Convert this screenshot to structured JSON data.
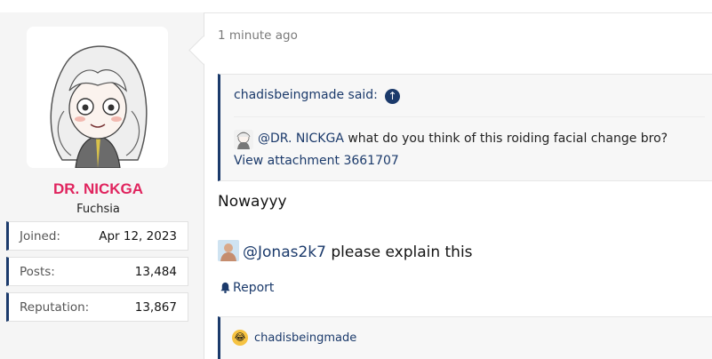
{
  "user": {
    "name": "DR. NICKGA",
    "title": "Fuchsia",
    "stats": [
      {
        "label": "Joined:",
        "value": "Apr 12, 2023"
      },
      {
        "label": "Posts:",
        "value": "13,484"
      },
      {
        "label": "Reputation:",
        "value": "13,867"
      }
    ]
  },
  "post": {
    "time": "1 minute ago",
    "quote": {
      "author": "chadisbeingmade said:",
      "mention": "@DR. NICKGA",
      "text": " what do you think of this roiding facial change bro?",
      "attachment": "View attachment 3661707"
    },
    "body_line1": "Nowayyy",
    "body_mention": "@Jonas2k7",
    "body_line2": " please explain this",
    "report_label": "Report",
    "reaction_user": "chadisbeingmade"
  },
  "colors": {
    "accent": "#1b3a6b",
    "username": "#e0245e",
    "reaction": "#f6c342"
  },
  "icons": {
    "quote_up": "arrow-up-circle-icon",
    "report": "bell-icon",
    "reaction": "crying-laughing-emoji-icon"
  }
}
